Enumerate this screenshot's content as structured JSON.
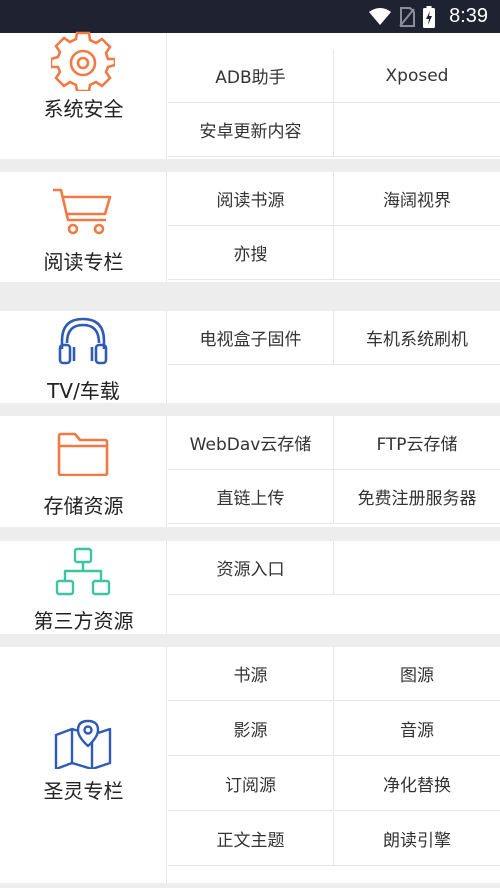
{
  "status": {
    "time": "8:39"
  },
  "sections": {
    "security": {
      "label": "系统安全",
      "items": [
        "ADB助手",
        "Xposed",
        "安卓更新内容"
      ]
    },
    "reading": {
      "label": "阅读专栏",
      "items": [
        "阅读书源",
        "海阔视界",
        "亦搜"
      ]
    },
    "tv": {
      "label": "TV/车载",
      "items": [
        "电视盒子固件",
        "车机系统刷机"
      ]
    },
    "storage": {
      "label": "存储资源",
      "items": [
        "WebDav云存储",
        "FTP云存储",
        "直链上传",
        "免费注册服务器"
      ]
    },
    "thirdparty": {
      "label": "第三方资源",
      "items": [
        "资源入口"
      ]
    },
    "shengling": {
      "label": "圣灵专栏",
      "items": [
        "书源",
        "图源",
        "影源",
        "音源",
        "订阅源",
        "净化替换",
        "正文主题",
        "朗读引擎"
      ]
    }
  },
  "colors": {
    "orange": "#f07a45",
    "blue": "#2f5bb5",
    "green": "#3cc5a0"
  }
}
